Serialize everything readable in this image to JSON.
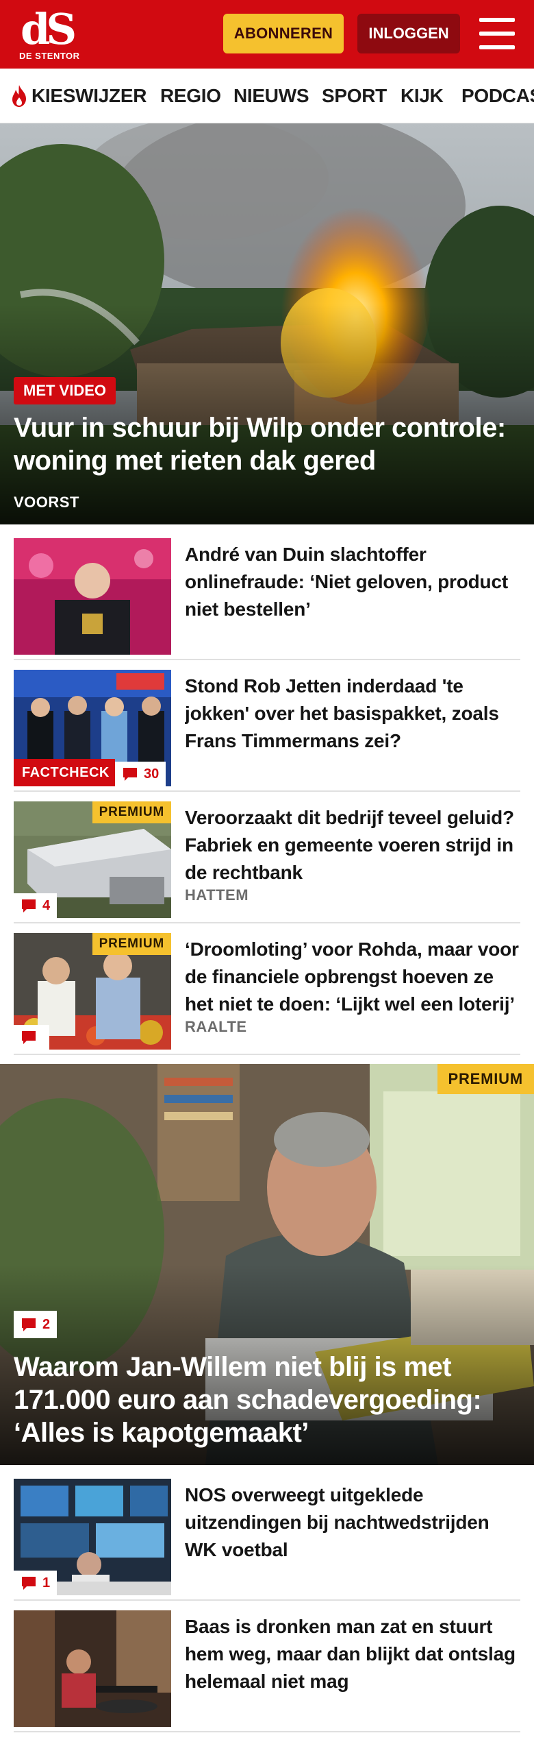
{
  "header": {
    "logo_mark": "dS",
    "logo_sub": "DE STENTOR",
    "subscribe_label": "ABONNEREN",
    "login_label": "INLOGGEN",
    "menu_icon": "hamburger-menu-icon",
    "brand_color": "#d10a11",
    "accent_color": "#f5c12e"
  },
  "nav": {
    "items": [
      {
        "label": "KIESWIJZER",
        "icon": "flame-icon"
      },
      {
        "label": "REGIO"
      },
      {
        "label": "NIEUWS"
      },
      {
        "label": "SPORT"
      },
      {
        "label": "KIJK"
      },
      {
        "label": "PODCASTS"
      }
    ]
  },
  "hero": {
    "badge": "MET VIDEO",
    "title": "Vuur in schuur bij Wilp onder controle: woning met rieten dak gered",
    "location": "VOORST"
  },
  "articles": [
    {
      "title": "André van Duin slachtoffer onlinefraude: ‘Niet geloven, product niet bestellen’"
    },
    {
      "title": "Stond Rob Jetten inderdaad 'te jokken' over het basispakket, zoals Frans Timmermans zei?",
      "tag": "FACTCHECK",
      "comments": "30"
    },
    {
      "title": "Veroorzaakt dit bedrijf teveel geluid? Fabriek en gemeente voeren strijd in de rechtbank",
      "premium": "PREMIUM",
      "comments": "4",
      "location": "HATTEM"
    },
    {
      "title": "‘Droomloting’ voor Rohda, maar voor de financiele opbrengst hoeven ze het niet te doen: ‘Lijkt wel een loterij’",
      "premium": "PREMIUM",
      "comments": "",
      "location": "RAALTE"
    }
  ],
  "feature": {
    "premium": "PREMIUM",
    "comments": "2",
    "title": "Waarom Jan-Willem niet blij is met 171.000 euro aan schadevergoeding: ‘Alles is kapotgemaakt’"
  },
  "articles2": [
    {
      "title": "NOS overweegt uitgeklede uitzendingen bij nachtwedstrijden WK voetbal",
      "comments": "1"
    },
    {
      "title": "Baas is dronken man zat en stuurt hem weg, maar dan blijkt dat ontslag helemaal niet mag"
    }
  ]
}
